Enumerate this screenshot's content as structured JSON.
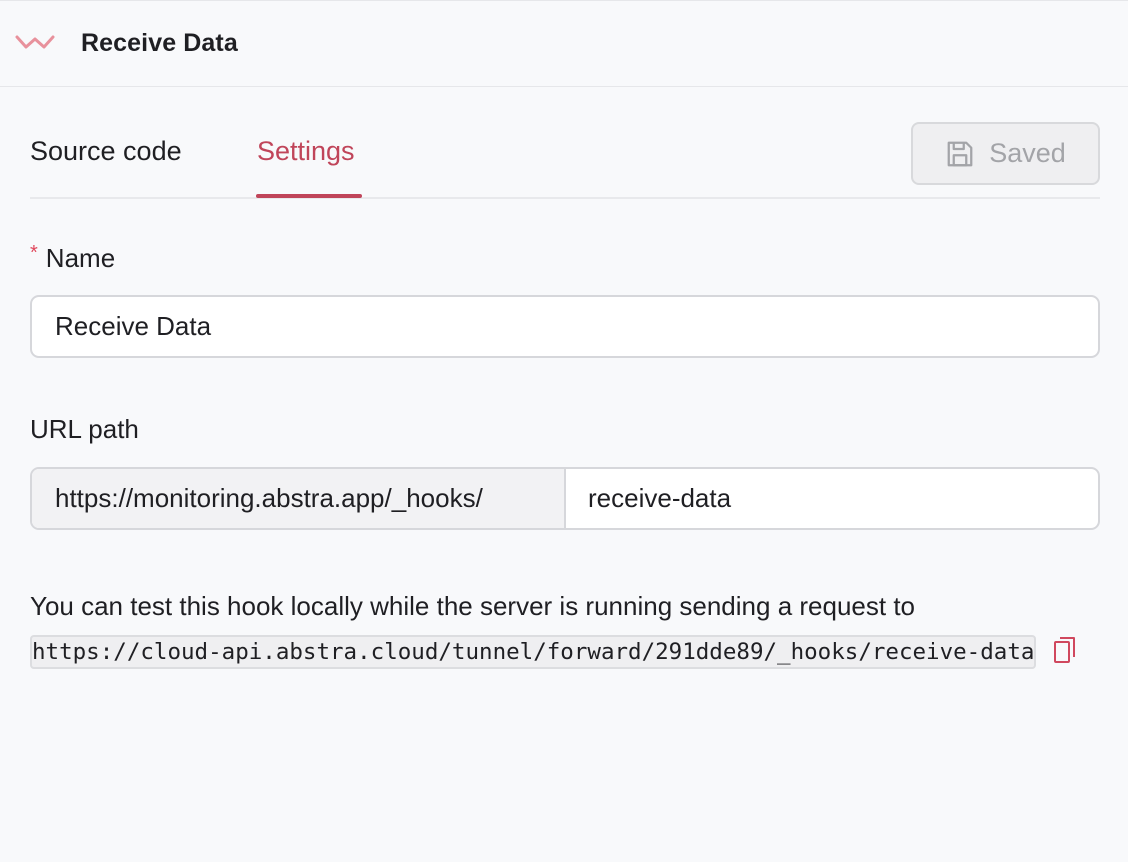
{
  "header": {
    "title": "Receive Data",
    "icon": "hook-icon",
    "accent_color": "#c0455a"
  },
  "tabs": [
    {
      "label": "Source code",
      "active": false
    },
    {
      "label": "Settings",
      "active": true
    }
  ],
  "save_button": {
    "label": "Saved",
    "icon": "save-icon",
    "disabled": true
  },
  "form": {
    "name": {
      "label": "Name",
      "required_mark": "*",
      "value": "Receive Data"
    },
    "url_path": {
      "label": "URL path",
      "prefix": "https://monitoring.abstra.app/_hooks/",
      "value": "receive-data"
    }
  },
  "help": {
    "text": "You can test this hook locally while the server is running sending a request to",
    "test_url": "https://cloud-api.abstra.cloud/tunnel/forward/291dde89/_hooks/receive-data",
    "copy_icon": "copy-icon"
  }
}
